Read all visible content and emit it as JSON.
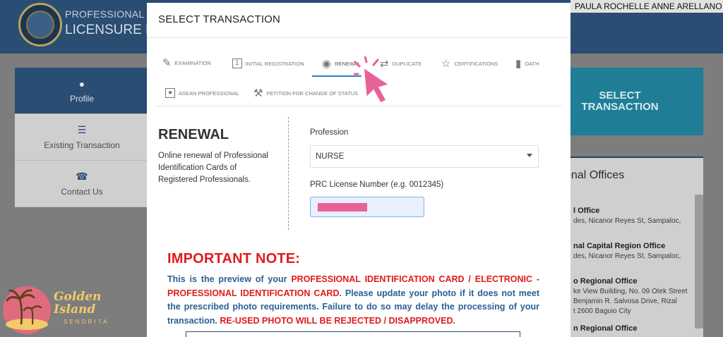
{
  "background": {
    "header_title_1": "PROFESSIONAL REGU",
    "header_title_2": "LICENSURE EXA",
    "user_name": "PAULA ROCHELLE ANNE ARELLANO AMOR",
    "sidebar": [
      {
        "label": "Profile",
        "icon": "person-icon"
      },
      {
        "label": "Existing Transaction",
        "icon": "list-icon"
      },
      {
        "label": "Contact Us",
        "icon": "phone-icon"
      }
    ],
    "select_transaction_button": "SELECT TRANSACTION",
    "offices_title": "onal Offices",
    "offices": [
      {
        "name": "l Office",
        "address": "des, Nicanor Reyes St, Sampaloc,"
      },
      {
        "name": "nal Capital Region Office",
        "address": "des, Nicanor Reyes St, Sampaloc,"
      },
      {
        "name": "o Regional Office",
        "address": "ke View Building, No. 09 Otek Street",
        "address2": "Benjamin R. Salvosa Drive, Rizal",
        "address3": "t 2600 Baguio City"
      },
      {
        "name": "n Regional Office"
      }
    ]
  },
  "modal": {
    "title": "SELECT TRANSACTION",
    "tabs": [
      {
        "label": "EXAMINATION",
        "icon": "pencil-icon",
        "active": false
      },
      {
        "label": "INITIAL REGISTRATION",
        "icon": "number-one-icon",
        "active": false
      },
      {
        "label": "RENEWAL",
        "icon": "fingerprint-icon",
        "active": true
      },
      {
        "label": "DUPLICATE",
        "icon": "repeat-icon",
        "active": false
      },
      {
        "label": "CERTIFICATIONS",
        "icon": "star-icon",
        "active": false
      },
      {
        "label": "OATH",
        "icon": "video-icon",
        "active": false
      },
      {
        "label": "ASEAN PROFESSIONAL",
        "icon": "id-card-icon",
        "active": false
      },
      {
        "label": "PETITION FOR CHANGE OF STATUS",
        "icon": "gavel-icon",
        "active": false
      }
    ],
    "section_title": "RENEWAL",
    "section_description": "Online renewal of Professional Identification Cards of Registered Professionals.",
    "profession_label": "Profession",
    "profession_value": "NURSE",
    "license_label": "PRC License Number (e.g. 0012345)",
    "important_title": "IMPORTANT NOTE:",
    "note_part1": "This is the preview of your ",
    "note_red1": "PROFESSIONAL IDENTIFICATION CARD / ELECTRONIC - PROFESSIONAL IDENTIFICATION CARD",
    "note_part2": ". Please update your photo if it does not meet the prescribed photo requirements. Failure to do so may delay the processing of your transaction. ",
    "note_red2": "RE-USED PHOTO WILL BE REJECTED / DISAPPROVED."
  },
  "watermark": {
    "line1": "Golden",
    "line2": "Island",
    "line3": "SENORITA"
  },
  "colors": {
    "header": "#2a4d73",
    "accent_blue": "#2f7fd0",
    "note_red": "#e01b1b",
    "note_blue": "#2a5f93",
    "highlight_pink": "#e8629a"
  }
}
